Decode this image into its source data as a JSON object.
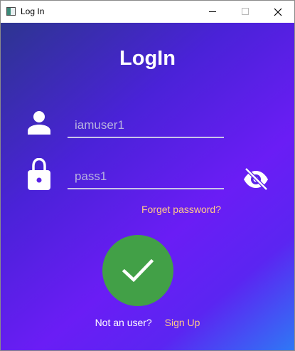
{
  "window": {
    "title": "Log In"
  },
  "main": {
    "heading": "LogIn",
    "username": {
      "value": "",
      "placeholder": "iamuser1"
    },
    "password": {
      "value": "",
      "placeholder": "pass1"
    },
    "forget_password": "Forget password?",
    "not_user_text": "Not an user?",
    "signup_link": "Sign Up"
  },
  "icons": {
    "user": "user-icon",
    "lock": "lock-icon",
    "password_visibility": "eye-off-icon",
    "submit": "checkmark-icon"
  },
  "colors": {
    "gradient_start": "#2d3590",
    "gradient_mid": "#6a1df5",
    "gradient_end": "#2f78f5",
    "submit_button": "#42a047",
    "link": "#ffc98a",
    "placeholder": "#b7b1df"
  }
}
